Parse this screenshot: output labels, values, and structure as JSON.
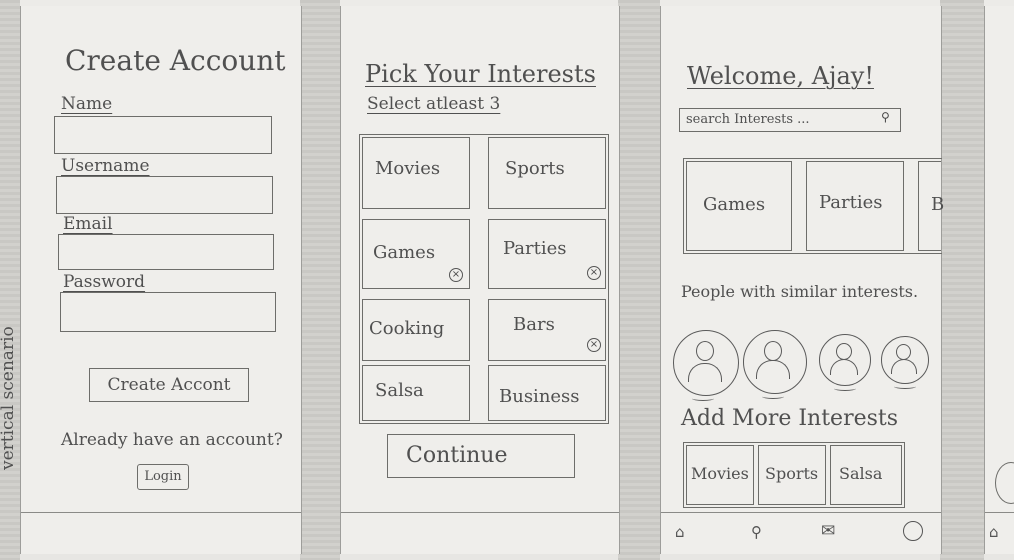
{
  "side_label": "vertical scenario",
  "create_account": {
    "title": "Create Account",
    "fields": [
      {
        "label": "Name",
        "value": ""
      },
      {
        "label": "Username",
        "value": ""
      },
      {
        "label": "Email",
        "value": ""
      },
      {
        "label": "Password",
        "value": ""
      }
    ],
    "submit_label": "Create Accont",
    "already_text": "Already have an account?",
    "login_label": "Login"
  },
  "pick_interests": {
    "title": "Pick Your Interests",
    "subtitle": "Select atleast 3",
    "tiles": [
      {
        "label": "Movies",
        "removable": false
      },
      {
        "label": "Sports",
        "removable": false
      },
      {
        "label": "Games",
        "removable": true
      },
      {
        "label": "Parties",
        "removable": true
      },
      {
        "label": "Cooking",
        "removable": false
      },
      {
        "label": "Bars",
        "removable": true
      },
      {
        "label": "Salsa",
        "removable": false
      },
      {
        "label": "Business",
        "removable": false
      }
    ],
    "continue_label": "Continue"
  },
  "welcome": {
    "title": "Welcome, Ajay!",
    "search_placeholder": "search Interests ...",
    "carousel": [
      "Games",
      "Parties",
      "B"
    ],
    "people_heading": "People with similar interests.",
    "add_more_heading": "Add More Interests",
    "add_more": [
      "Movies",
      "Sports",
      "Salsa"
    ]
  },
  "icons": {
    "remove": "remove-circle-icon",
    "search": "search-icon",
    "home": "home-icon",
    "mail": "mail-icon",
    "profile": "profile-icon"
  }
}
